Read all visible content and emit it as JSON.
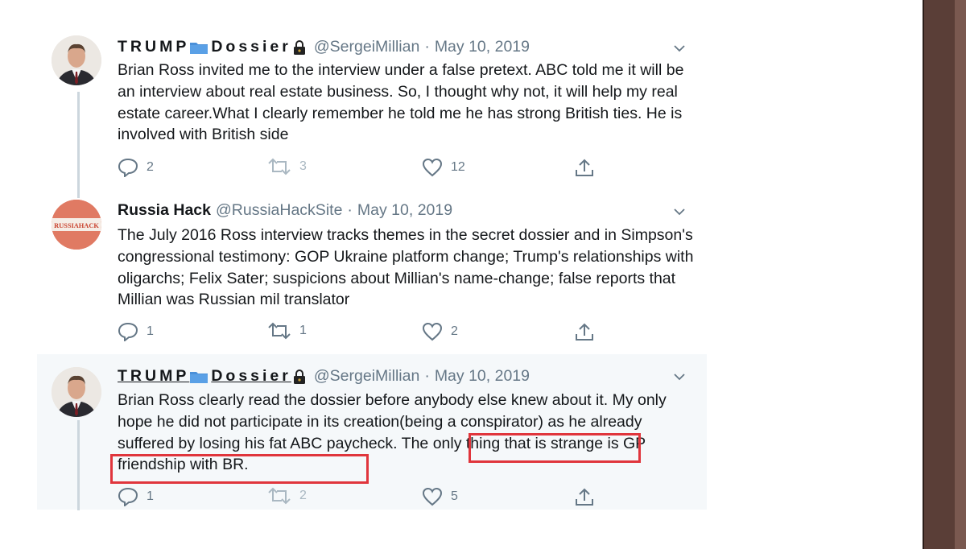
{
  "colors": {
    "accent": "#e0353c",
    "muted": "#657786",
    "text": "#14171a"
  },
  "tweets": [
    {
      "name_prefix": "TRUMP",
      "name_suffix": "Dossier",
      "handle": "@SergeiMillian",
      "separator": "·",
      "date": "May 10, 2019",
      "text": "Brian Ross invited me to the interview under a false pretext. ABC told me it will be an interview about real estate business. So, I thought why not, it will help my real estate career.What I clearly remember he told me he has strong British ties. He is involved with British side",
      "replies": "2",
      "retweets": "3",
      "likes": "12"
    },
    {
      "name": "Russia Hack",
      "avatar_text": "RUSSIAHACK",
      "handle": "@RussiaHackSite",
      "separator": "·",
      "date": "May 10, 2019",
      "text": "The July 2016 Ross interview tracks themes in the secret dossier and in Simpson's congressional testimony: GOP Ukraine platform change; Trump's relationships with oligarchs; Felix Sater; suspicions about Millian's name-change; false reports that Millian was Russian mil translator",
      "replies": "1",
      "retweets": "1",
      "likes": "2"
    },
    {
      "name_prefix": "TRUMP",
      "name_suffix": "Dossier",
      "handle": "@SergeiMillian",
      "separator": "·",
      "date": "May 10, 2019",
      "text_part1": "Brian Ross clearly read the dossier before anybody else knew about it. My only hope he did not participate in its creation(being a conspirator) as he already suffered by losing his fat ABC paycheck.",
      "text_part2": "The only thing that is",
      "text_part3": "strange is GP friendship with BR.",
      "replies": "1",
      "retweets": "2",
      "likes": "5"
    }
  ]
}
